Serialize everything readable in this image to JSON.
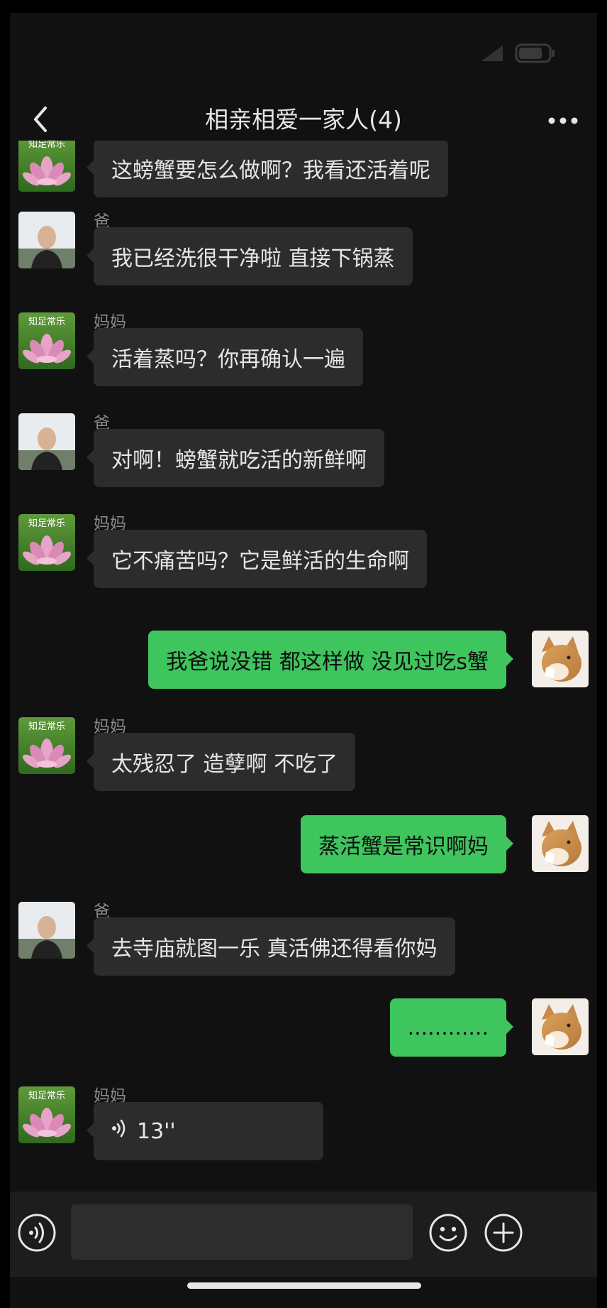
{
  "status_bar": {
    "time": ""
  },
  "header": {
    "title": "相亲相爱一家人(4)"
  },
  "avatars": {
    "mom_text": "知足常乐"
  },
  "messages": [
    {
      "sender": "妈妈",
      "side": "in",
      "avatar": "mom",
      "text": "这螃蟹要怎么做啊？我看还活着呢"
    },
    {
      "sender": "爸",
      "side": "in",
      "avatar": "dad",
      "text": "我已经洗很干净啦 直接下锅蒸"
    },
    {
      "sender": "妈妈",
      "side": "in",
      "avatar": "mom",
      "text": "活着蒸吗？你再确认一遍"
    },
    {
      "sender": "爸",
      "side": "in",
      "avatar": "dad",
      "text": "对啊！螃蟹就吃活的新鲜啊"
    },
    {
      "sender": "妈妈",
      "side": "in",
      "avatar": "mom",
      "text": "它不痛苦吗？它是鲜活的生命啊"
    },
    {
      "sender": "",
      "side": "out",
      "avatar": "me",
      "text": "我爸说没错 都这样做 没见过吃s蟹"
    },
    {
      "sender": "妈妈",
      "side": "in",
      "avatar": "mom",
      "text": "太残忍了 造孽啊 不吃了"
    },
    {
      "sender": "",
      "side": "out",
      "avatar": "me",
      "text": "蒸活蟹是常识啊妈"
    },
    {
      "sender": "爸",
      "side": "in",
      "avatar": "dad",
      "text": "去寺庙就图一乐 真活佛还得看你妈"
    },
    {
      "sender": "",
      "side": "out",
      "avatar": "me",
      "text": "............"
    },
    {
      "sender": "妈妈",
      "side": "in",
      "avatar": "mom",
      "type": "voice",
      "text": "13''"
    }
  ],
  "input": {
    "value": "",
    "placeholder": ""
  },
  "icons": {
    "back": "chevron-left-icon",
    "more": "more-icon",
    "voice": "voice-icon",
    "emoji": "emoji-icon",
    "add": "plus-icon"
  },
  "colors": {
    "background": "#111111",
    "incoming_bubble": "#2c2c2c",
    "outgoing_bubble": "#3ec55e",
    "text": "#e6e6e6",
    "sender_name": "#8a8a8a"
  }
}
